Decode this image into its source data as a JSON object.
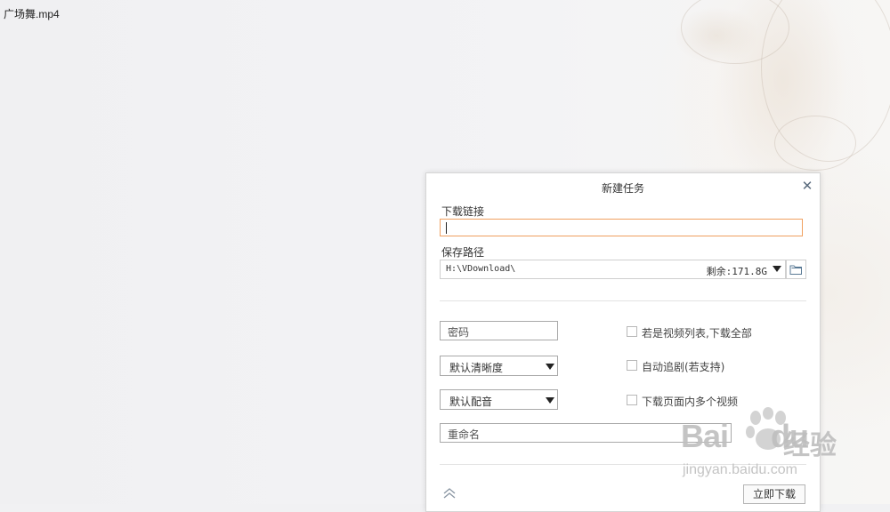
{
  "window": {
    "file_title": "广场舞.mp4"
  },
  "dialog": {
    "title": "新建任务",
    "close_icon": "close-icon",
    "url_label": "下载链接",
    "url_value": "",
    "path_label": "保存路径",
    "path_value": "H:\\VDownload\\",
    "free_space": "剩余:171.8G",
    "password_placeholder": "密码",
    "quality_select": "默认清晰度",
    "audio_select": "默认配音",
    "rename_placeholder": "重命名",
    "options": [
      {
        "label": "若是视频列表,下载全部",
        "checked": false
      },
      {
        "label": "自动追剧(若支持)",
        "checked": false
      },
      {
        "label": "下载页面内多个视频",
        "checked": false
      }
    ],
    "download_button": "立即下载"
  },
  "watermark": {
    "brand": "Bai",
    "brand_suffix": "du",
    "cn": "经验",
    "url": "jingyan.baidu.com"
  },
  "colors": {
    "input_focus_border": "#f0a060",
    "close_icon": "#5a6b7d",
    "background": "#f1f1f3"
  }
}
